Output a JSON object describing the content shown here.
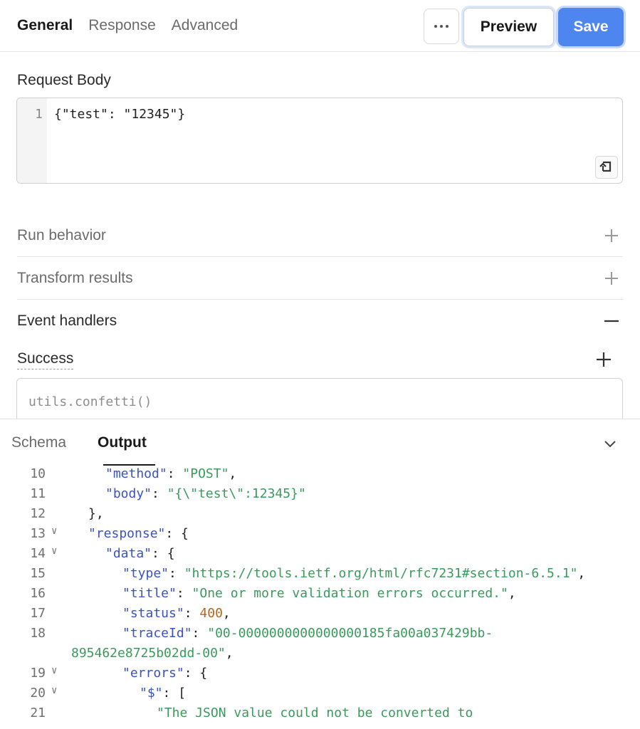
{
  "header": {
    "tabs": [
      "General",
      "Response",
      "Advanced"
    ],
    "active_tab": "General",
    "more_icon": "ellipsis-icon",
    "preview_label": "Preview",
    "save_label": "Save",
    "accent_color": "#4c86ee"
  },
  "request_body": {
    "label": "Request Body",
    "line_number": "1",
    "code": "{\"test\": \"12345\"}",
    "reset_icon": "reset-icon"
  },
  "sections": [
    {
      "label": "Run behavior",
      "state": "collapsed"
    },
    {
      "label": "Transform results",
      "state": "collapsed"
    },
    {
      "label": "Event handlers",
      "state": "expanded"
    }
  ],
  "success": {
    "label": "Success",
    "placeholder": "utils.confetti()"
  },
  "bottom_panel": {
    "tabs": [
      "Schema",
      "Output"
    ],
    "active_tab": "Output",
    "collapse_icon": "chevron-down-icon",
    "lines": [
      {
        "num": "10",
        "fold": false,
        "indent": 2,
        "tokens": [
          [
            "k",
            "\"method\""
          ],
          [
            "p",
            ": "
          ],
          [
            "s",
            "\"POST\""
          ],
          [
            "p",
            ","
          ]
        ]
      },
      {
        "num": "11",
        "fold": false,
        "indent": 2,
        "tokens": [
          [
            "k",
            "\"body\""
          ],
          [
            "p",
            ": "
          ],
          [
            "s",
            "\"{\\\"test\\\":12345}\""
          ]
        ]
      },
      {
        "num": "12",
        "fold": false,
        "indent": 1,
        "tokens": [
          [
            "p",
            "},"
          ]
        ]
      },
      {
        "num": "13",
        "fold": true,
        "indent": 1,
        "tokens": [
          [
            "k",
            "\"response\""
          ],
          [
            "p",
            ": {"
          ]
        ]
      },
      {
        "num": "14",
        "fold": true,
        "indent": 2,
        "tokens": [
          [
            "k",
            "\"data\""
          ],
          [
            "p",
            ": {"
          ]
        ]
      },
      {
        "num": "15",
        "fold": false,
        "indent": 3,
        "tokens": [
          [
            "k",
            "\"type\""
          ],
          [
            "p",
            ": "
          ],
          [
            "s",
            "\"https://tools.ietf.org/html/rfc7231#section-6.5.1\""
          ],
          [
            "p",
            ","
          ]
        ]
      },
      {
        "num": "16",
        "fold": false,
        "indent": 3,
        "tokens": [
          [
            "k",
            "\"title\""
          ],
          [
            "p",
            ": "
          ],
          [
            "s",
            "\"One or more validation errors occurred.\""
          ],
          [
            "p",
            ","
          ]
        ]
      },
      {
        "num": "17",
        "fold": false,
        "indent": 3,
        "tokens": [
          [
            "k",
            "\"status\""
          ],
          [
            "p",
            ": "
          ],
          [
            "n",
            "400"
          ],
          [
            "p",
            ","
          ]
        ]
      },
      {
        "num": "18",
        "fold": false,
        "indent": 3,
        "tokens": [
          [
            "k",
            "\"traceId\""
          ],
          [
            "p",
            ": "
          ],
          [
            "s",
            "\"00-0000000000000000185fa00a037429bb-"
          ]
        ]
      },
      {
        "num": "",
        "fold": false,
        "indent": 0,
        "tokens": [
          [
            "s",
            "895462e8725b02dd-00\""
          ],
          [
            "p",
            ","
          ]
        ]
      },
      {
        "num": "19",
        "fold": true,
        "indent": 3,
        "tokens": [
          [
            "k",
            "\"errors\""
          ],
          [
            "p",
            ": {"
          ]
        ]
      },
      {
        "num": "20",
        "fold": true,
        "indent": 4,
        "tokens": [
          [
            "k",
            "\"$\""
          ],
          [
            "p",
            ": ["
          ]
        ]
      },
      {
        "num": "21",
        "fold": false,
        "indent": 5,
        "tokens": [
          [
            "s",
            "\"The JSON value could not be converted to"
          ]
        ]
      }
    ]
  }
}
